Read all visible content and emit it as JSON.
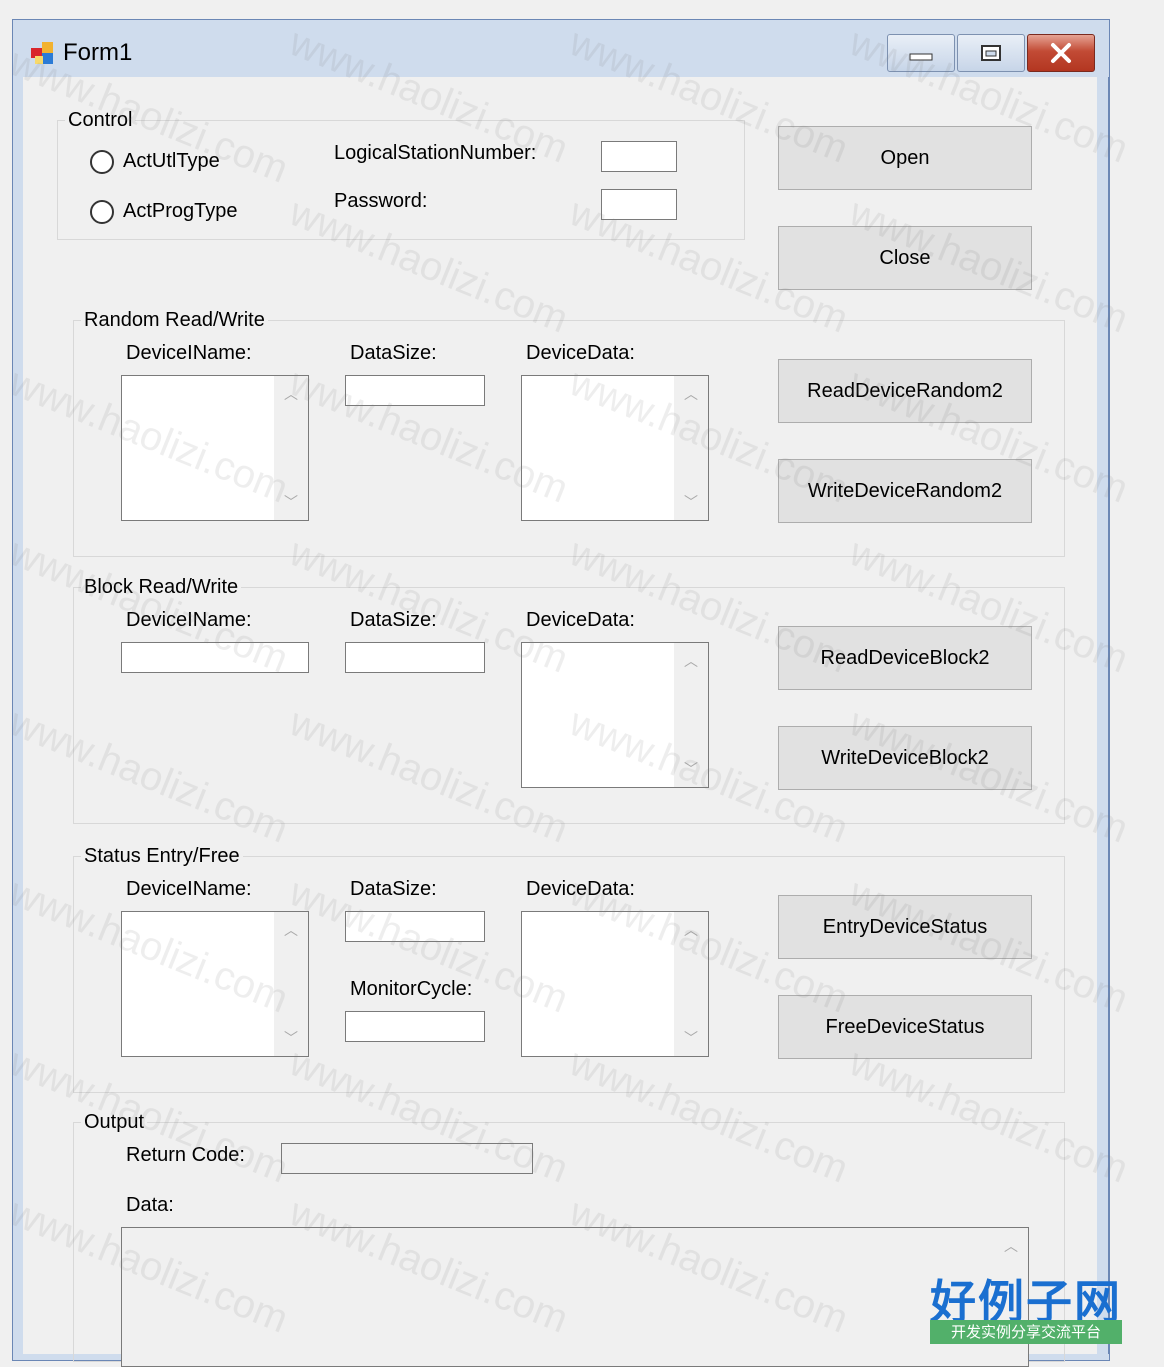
{
  "window": {
    "title": "Form1"
  },
  "titlebar_buttons": {
    "minimize": "minimize-icon",
    "maximize": "restore-icon",
    "close": "close-icon"
  },
  "control": {
    "group_label": "Control",
    "radio1": "ActUtlType",
    "radio2": "ActProgType",
    "station_label": "LogicalStationNumber:",
    "station_value": "",
    "password_label": "Password:",
    "password_value": ""
  },
  "buttons": {
    "open": "Open",
    "close": "Close",
    "read_random": "ReadDeviceRandom2",
    "write_random": "WriteDeviceRandom2",
    "read_block": "ReadDeviceBlock2",
    "write_block": "WriteDeviceBlock2",
    "entry_status": "EntryDeviceStatus",
    "free_status": "FreeDeviceStatus"
  },
  "random": {
    "group_label": "Random Read/Write",
    "device_name_label": "DeviceIName:",
    "data_size_label": "DataSize:",
    "device_data_label": "DeviceData:"
  },
  "block": {
    "group_label": "Block Read/Write",
    "device_name_label": "DeviceIName:",
    "data_size_label": "DataSize:",
    "device_data_label": "DeviceData:"
  },
  "status": {
    "group_label": "Status Entry/Free",
    "device_name_label": "DeviceIName:",
    "data_size_label": "DataSize:",
    "monitor_cycle_label": "MonitorCycle:",
    "device_data_label": "DeviceData:"
  },
  "output": {
    "group_label": "Output",
    "return_code_label": "Return Code:",
    "return_code_value": "",
    "data_label": "Data:"
  },
  "watermark_text": "www.haolizi.com",
  "logo": {
    "main": "好例子网",
    "sub": "开发实例分享交流平台"
  }
}
